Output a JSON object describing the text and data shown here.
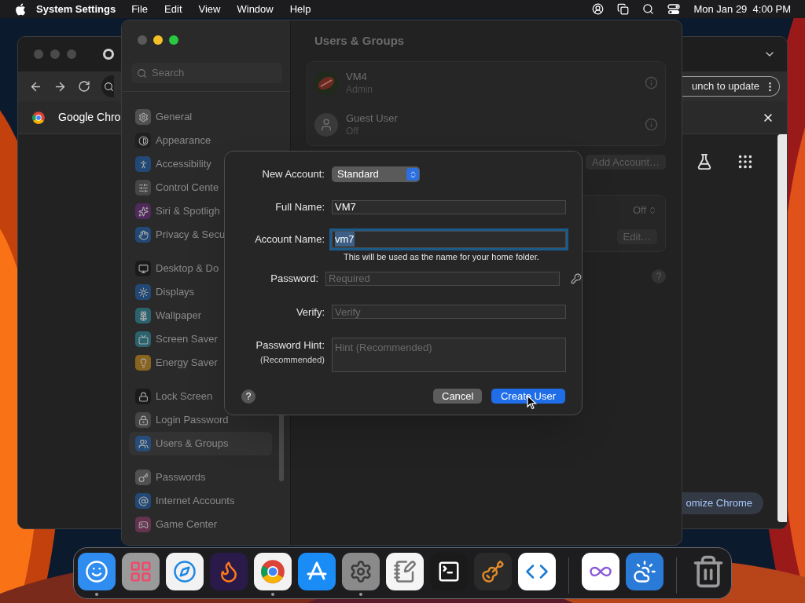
{
  "menu_bar": {
    "app_name": "System Settings",
    "menus": [
      "File",
      "Edit",
      "View",
      "Window",
      "Help"
    ],
    "clock": "Mon Jan 29  4:00 PM"
  },
  "browser": {
    "update_button": "unch to update",
    "tab_title": "Google Chro",
    "customize_button": "omize Chrome"
  },
  "settings": {
    "search": {
      "placeholder": "Search"
    },
    "sidebar": [
      [
        {
          "label": "General",
          "selected": false
        },
        {
          "label": "Appearance",
          "selected": false
        },
        {
          "label": "Accessibility",
          "selected": false
        },
        {
          "label": "Control Cente",
          "selected": false
        },
        {
          "label": "Siri & Spotligh",
          "selected": false
        },
        {
          "label": "Privacy & Secu",
          "selected": false
        }
      ],
      [
        {
          "label": "Desktop & Do",
          "selected": false
        },
        {
          "label": "Displays",
          "selected": false
        },
        {
          "label": "Wallpaper",
          "selected": false
        },
        {
          "label": "Screen Saver",
          "selected": false
        },
        {
          "label": "Energy Saver",
          "selected": false
        }
      ],
      [
        {
          "label": "Lock Screen",
          "selected": false
        },
        {
          "label": "Login Password",
          "selected": false
        },
        {
          "label": "Users & Groups",
          "selected": true
        }
      ],
      [
        {
          "label": "Passwords",
          "selected": false
        },
        {
          "label": "Internet Accounts",
          "selected": false
        },
        {
          "label": "Game Center",
          "selected": false
        }
      ]
    ],
    "title": "Users & Groups",
    "users": [
      {
        "name": "VM4",
        "role": "Admin",
        "kind": "picture"
      },
      {
        "name": "Guest User",
        "role": "Off",
        "kind": "silhouette"
      }
    ],
    "add_account_button": "Add Account…",
    "options": [
      {
        "kind": "popup",
        "value": "Off"
      },
      {
        "kind": "button",
        "value": "Edit…"
      }
    ],
    "help_button": "?"
  },
  "sheet": {
    "fields": [
      {
        "kind": "popup",
        "label": "New Account:",
        "value": "Standard"
      },
      {
        "kind": "text",
        "label": "Full Name:",
        "value": "VM7",
        "focused": false
      },
      {
        "kind": "text",
        "label": "Account Name:",
        "value": "vm7",
        "focused": true,
        "text_selected": true,
        "note": "This will be used as the name for your home folder."
      },
      {
        "kind": "password",
        "label": "Password:",
        "placeholder": "Required",
        "focused": false
      },
      {
        "kind": "text",
        "label": "Verify:",
        "placeholder": "Verify",
        "focused": false
      },
      {
        "kind": "textarea",
        "label": "Password Hint:",
        "sublabel": "(Recommended)",
        "placeholder": "Hint (Recommended)",
        "focused": false
      }
    ],
    "help_button": "?",
    "buttons": [
      {
        "label": "Cancel",
        "default": false
      },
      {
        "label": "Create User",
        "default": true
      }
    ]
  },
  "dock": {
    "items": [
      {
        "kind": "app",
        "running": true
      },
      {
        "kind": "app",
        "running": false
      },
      {
        "kind": "app",
        "running": false
      },
      {
        "kind": "app",
        "running": false
      },
      {
        "kind": "app",
        "running": true
      },
      {
        "kind": "app",
        "running": false
      },
      {
        "kind": "app",
        "running": true
      },
      {
        "kind": "app",
        "running": false
      },
      {
        "kind": "app",
        "running": false
      },
      {
        "kind": "app",
        "running": false
      },
      {
        "kind": "app",
        "running": false
      },
      {
        "kind": "separator"
      },
      {
        "kind": "app",
        "running": false
      },
      {
        "kind": "app",
        "running": false
      },
      {
        "kind": "separator"
      },
      {
        "kind": "app",
        "running": false
      }
    ]
  }
}
